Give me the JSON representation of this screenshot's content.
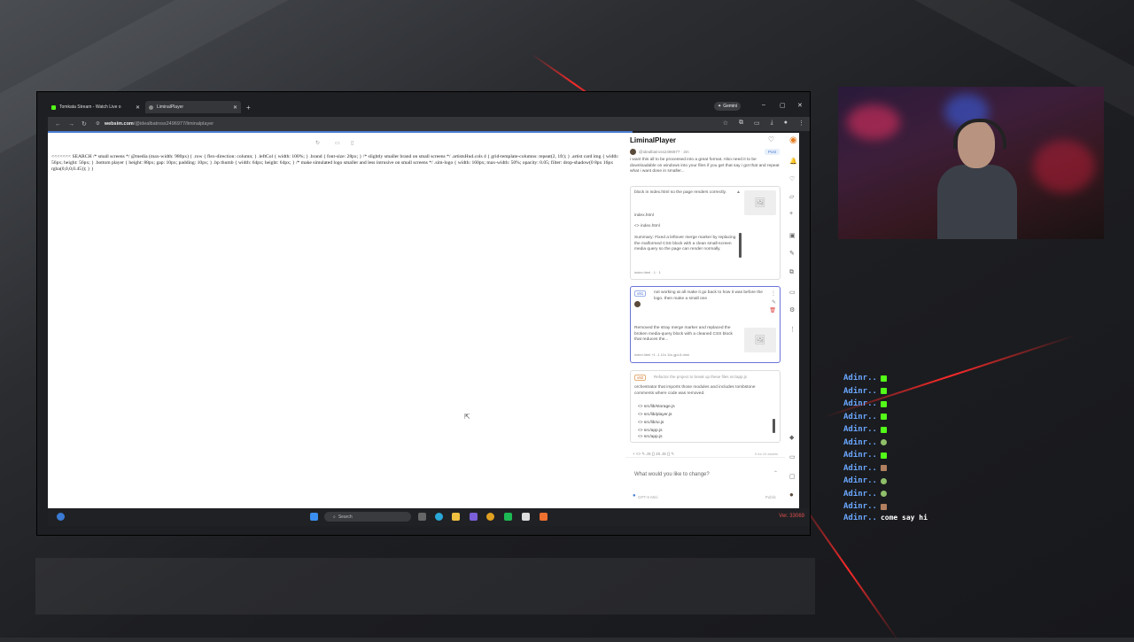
{
  "browser": {
    "tabs": [
      {
        "label": "Tomkata Stream - Watch Live o",
        "favicon_color": "#53fc18",
        "active": false
      },
      {
        "label": "LiminalPlayer",
        "favicon_color": "#888888",
        "active": true
      }
    ],
    "new_tab_glyph": "+",
    "gemini_label": "Gemini",
    "url_host": "websim.com",
    "url_path": "/@idealbatross2496977/liminalplayer",
    "minimize_glyph": "–",
    "maximize_glyph": "▢",
    "close_glyph": "✕"
  },
  "page": {
    "code_text": "<<<<<<< SEARCH /* small screens */ @media (max-width: 980px) { .row { flex-direction: column; } .leftCol { width: 100%; } .brand { font-size: 28px; } /* slightly smaller brand on small screens */ .artistsHud.cols 4 { grid-template-columns: repeat(2, 1fr); } .artist card img { width: 56px; height: 56px; } .bottom player { height: 88px; gap: 10px; padding: 10px; } .bp thumb { width: 64px; height: 64px; } /* make simulated logo smaller and less intrusive on small screens */ .sim-logo { width: 160px; max-width: 50%; opacity: 0.05; filter: drop-shadow(0 8px 16px rgba(0,0,0,0.45)); } }"
  },
  "websim": {
    "title": "LiminalPlayer",
    "author": "@idealbatross2496977 · 2m",
    "post_label": "Post",
    "prompt": "i want this all to be processed into a great format. Also need it to be downloadable on windows into your files if you get that say i got that and repeat what i want done in smaller...",
    "card1": {
      "line1": "block in index.html so the page renders correctly.",
      "file_header": "index.html",
      "file": "<> index.html",
      "summary": "Summary: Fixed a leftover merge marker by replacing the malformed CSS block with a clean small-screen media query so the page can render normally.",
      "chip": "index.html · 1 · 1"
    },
    "card2": {
      "badge": "v91",
      "prompt": "not working at all make it go back to how it was before the logo. then make a small one",
      "reply": "Removed the stray merge marker and replaced the broken media-query block with a cleaned CSS block that reduces the...",
      "chips": "index.html +1 -1   11s   11s   gpt-5-mini"
    },
    "card3": {
      "badge": "v92",
      "prompt": "Refactor the project to break up these files src/app.js",
      "reply": "orchestrator that imports those modules and includes tombstone comments where code was removed.",
      "files": [
        "<> src/lib/storage.js",
        "<> src/lib/player.js",
        "<> src/lib/ui.js",
        "<> src/app.js",
        "<> src/app.js"
      ]
    },
    "toolbar_glyphs": "+  <>  ✎  JS  {}  JS  JS  {}  ✎",
    "credits": "0 ea 10 assets",
    "input_placeholder": "What would you like to change?",
    "model_label": "GPT-5 Mini",
    "visibility_label": "Public"
  },
  "taskbar": {
    "search_placeholder": "Search",
    "version_text": "Ver. 33069"
  },
  "chat": [
    {
      "name": "Adinr..",
      "emote_color": "#53fc18",
      "message": ""
    },
    {
      "name": "Adinr..",
      "emote_color": "#53fc18",
      "message": ""
    },
    {
      "name": "Adinr..",
      "emote_color": "#53fc18",
      "message": ""
    },
    {
      "name": "Adinr..",
      "emote_color": "#53fc18",
      "message": ""
    },
    {
      "name": "Adinr..",
      "emote_color": "#53fc18",
      "message": ""
    },
    {
      "name": "Adinr..",
      "emote_color": "#8fbf6a",
      "message": ""
    },
    {
      "name": "Adinr..",
      "emote_color": "#53fc18",
      "message": ""
    },
    {
      "name": "Adinr..",
      "emote_color": "#b08060",
      "message": ""
    },
    {
      "name": "Adinr..",
      "emote_color": "#8fbf6a",
      "message": ""
    },
    {
      "name": "Adinr..",
      "emote_color": "#8fbf6a",
      "message": ""
    },
    {
      "name": "Adinr..",
      "emote_color": "#b08060",
      "message": ""
    },
    {
      "name": "Adinr..",
      "emote_color": "",
      "message": "come say hi"
    }
  ],
  "colors": {
    "accent_red": "#ff2a2a",
    "chat_name": "#6aa7ff",
    "selected_card": "#6b73d8"
  }
}
